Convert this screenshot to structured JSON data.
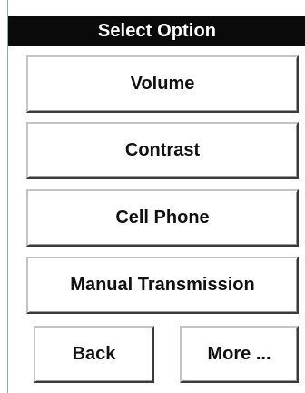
{
  "dialog": {
    "title": "Select Option",
    "options": [
      {
        "label": "Volume"
      },
      {
        "label": "Contrast"
      },
      {
        "label": "Cell Phone"
      },
      {
        "label": "Manual Transmission"
      }
    ],
    "back_label": "Back",
    "more_label": "More ..."
  },
  "colors": {
    "title_bar_bg": "#0a0a0a",
    "title_text": "#ffffff",
    "button_bg": "#ffffff",
    "button_text": "#111111",
    "panel_edge": "#8ab0a6"
  }
}
